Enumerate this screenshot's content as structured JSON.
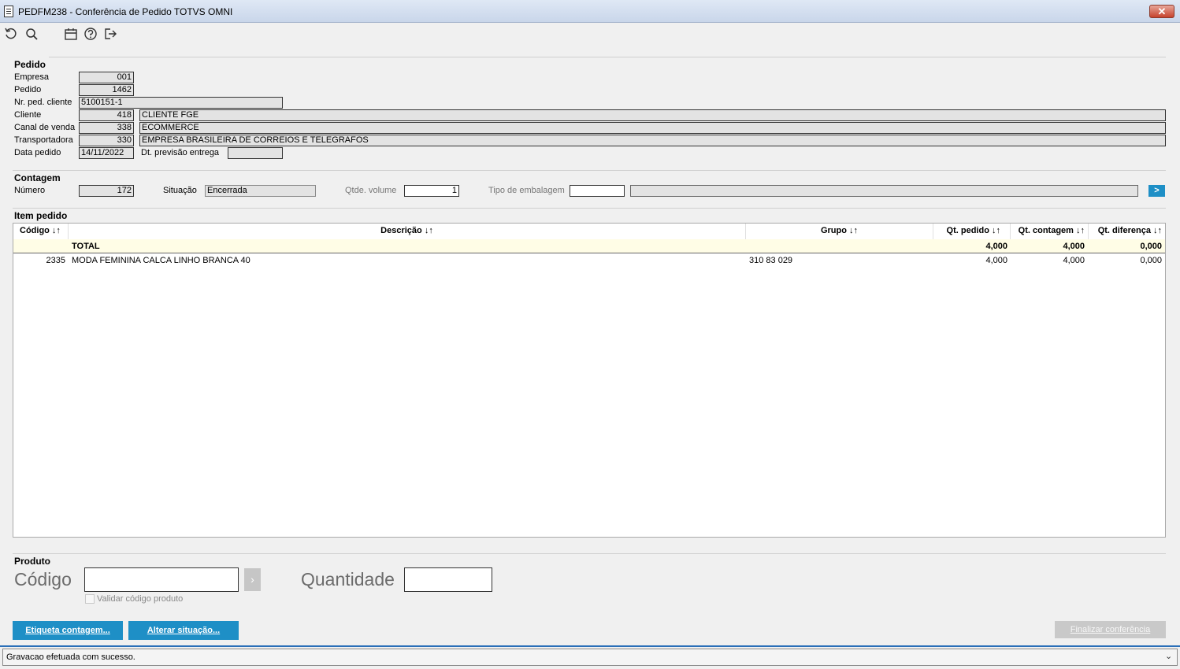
{
  "window": {
    "title": "PEDFM238 - Conferência de Pedido TOTVS OMNI",
    "close_label": "✕"
  },
  "toolbar": {
    "icons": [
      "refresh-icon",
      "search-icon",
      "calendar-icon",
      "help-icon",
      "exit-icon"
    ]
  },
  "pedido": {
    "section_title": "Pedido",
    "empresa_label": "Empresa",
    "empresa_value": "001",
    "pedido_label": "Pedido",
    "pedido_value": "1462",
    "nr_ped_cliente_label": "Nr. ped. cliente",
    "nr_ped_cliente_value": "5100151-1",
    "cliente_label": "Cliente",
    "cliente_code": "418",
    "cliente_name": "CLIENTE FGE",
    "canal_label": "Canal de venda",
    "canal_code": "338",
    "canal_name": "ECOMMERCE",
    "transportadora_label": "Transportadora",
    "transportadora_code": "330",
    "transportadora_name": "EMPRESA BRASILEIRA DE CORREIOS E TELEGRAFOS",
    "data_pedido_label": "Data pedido",
    "data_pedido_value": "14/11/2022",
    "dt_previsao_label": "Dt. previsão entrega",
    "dt_previsao_value": ""
  },
  "contagem": {
    "section_title": "Contagem",
    "numero_label": "Número",
    "numero_value": "172",
    "situacao_label": "Situação",
    "situacao_value": "Encerrada",
    "qtde_volume_label": "Qtde. volume",
    "qtde_volume_value": "1",
    "tipo_embalagem_label": "Tipo de embalagem",
    "tipo_embalagem_code": "",
    "tipo_embalagem_desc": "",
    "go_label": ">"
  },
  "item_pedido": {
    "section_title": "Item pedido",
    "columns": [
      "Código ↓↑",
      "Descrição ↓↑",
      "Grupo ↓↑",
      "Qt. pedido ↓↑",
      "Qt. contagem ↓↑",
      "Qt. diferença ↓↑"
    ],
    "total": {
      "label": "TOTAL",
      "qt_pedido": "4,000",
      "qt_contagem": "4,000",
      "qt_diferenca": "0,000"
    },
    "rows": [
      {
        "codigo": "2335",
        "descricao": "MODA FEMININA CALCA LINHO BRANCA 40",
        "grupo": "310 83 029",
        "qt_pedido": "4,000",
        "qt_contagem": "4,000",
        "qt_diferenca": "0,000"
      }
    ]
  },
  "produto": {
    "section_title": "Produto",
    "codigo_label": "Código",
    "codigo_value": "",
    "go_label": "›",
    "quantidade_label": "Quantidade",
    "quantidade_value": "",
    "validar_label": "Validar código produto"
  },
  "buttons": {
    "etiqueta": "Etiqueta contagem...",
    "alterar": "Alterar situação...",
    "finalizar": "Finalizar conferência"
  },
  "status": {
    "message": "Gravacao efetuada com sucesso.",
    "dropdown_icon": "⌄"
  },
  "colors": {
    "accent": "#1e8fc6",
    "total_row_bg": "#fffde6",
    "window_bg": "#f0f0f0"
  }
}
